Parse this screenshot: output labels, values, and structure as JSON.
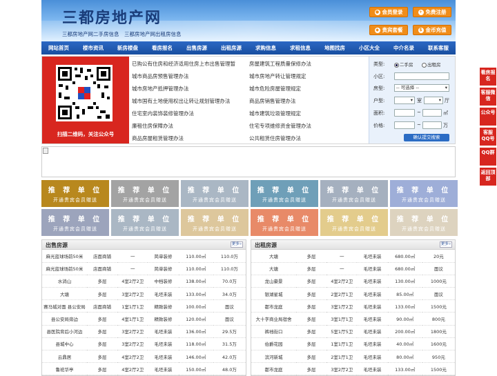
{
  "header": {
    "logo": "三都房地产网",
    "tagline": "三都房地产网二手房信息　三都房地产网出租房信息",
    "buttons": {
      "login": "会员登录",
      "register": "免费注册",
      "package": "贵宾套餐",
      "recharge": "金币充值"
    }
  },
  "nav": [
    "网站首页",
    "楼市资讯",
    "新房楼盘",
    "看房报名",
    "出售房源",
    "出租房源",
    "求购信息",
    "求租信息",
    "地图找房",
    "小区大全",
    "中介名录",
    "联系客服"
  ],
  "qr": {
    "caption": "扫描二维码，关注公众号"
  },
  "links": [
    [
      "已购公有住房和经济适用住房上市出售管理暂",
      "房屋建筑工程质量保修办法"
    ],
    [
      "城市商品房预售管理办法",
      "城市房地产转让管理规定"
    ],
    [
      "城市房地产抵押管理办法",
      "城市危险房屋管理规定"
    ],
    [
      "城市国有土地使用权出让转让规划管理办法",
      "商品房销售管理办法"
    ],
    [
      "住宅室内装饰装修管理办法",
      "城市建筑垃圾管理规定"
    ],
    [
      "廉租住房保障办法",
      "住宅专项维修资金管理办法"
    ],
    [
      "商品房屋租赁管理办法",
      "公共租赁住房管理办法"
    ]
  ],
  "search": {
    "type_label": "类型:",
    "opt_sale": "二手房",
    "opt_rent": "出租房",
    "district_label": "小区:",
    "housetype_label": "房型:",
    "housetype_value": "-- 可选择 --",
    "layout_label": "户型:",
    "room_unit": "室",
    "hall_unit": "厅",
    "area_label": "面积:",
    "area_unit": "㎡",
    "price_label": "价格:",
    "price_unit": "万",
    "range_sep": "~",
    "submit": "确认提交搜索"
  },
  "ads": {
    "title": "推 荐 单 位",
    "sub": "开通贵宾会员赠送",
    "colors": [
      "#b8881e",
      "#a3a3a3",
      "#aab7c4",
      "#6f9fb8",
      "#a5b0bf",
      "#9eaed8",
      "#9ca4bc",
      "#aab7c4",
      "#ddc79c",
      "#e88a68",
      "#e3cc8c",
      "#ddd3bf"
    ]
  },
  "sale": {
    "title": "出售房源",
    "more": "更多»",
    "rows": [
      [
        "麻光蓝球场前50米",
        "店面商铺",
        "一",
        "简单装修",
        "110.00㎡",
        "110.0万"
      ],
      [
        "麻光蓝球场前50米",
        "店面商铺",
        "一",
        "简单装修",
        "110.00㎡",
        "110.0万"
      ],
      [
        "水淌山",
        "多层",
        "4室2厅2卫",
        "中档装修",
        "138.00㎡",
        "70.0万"
      ],
      [
        "大塘",
        "多层",
        "3室2厅2卫",
        "毛坯未装",
        "133.00㎡",
        "34.0万"
      ],
      [
        "赛马城对面 县公安局",
        "店面商铺",
        "1室1厅1卫",
        "精致装修",
        "100.00㎡",
        "面议"
      ],
      [
        "县公安局旁边",
        "多层",
        "4室1厅1卫",
        "精致装修",
        "120.00㎡",
        "面议"
      ],
      [
        "县医院背后小河边",
        "多层",
        "3室2厅2卫",
        "毛坯未装",
        "136.00㎡",
        "29.5万"
      ],
      [
        "县城中心",
        "多层",
        "3室2厅2卫",
        "毛坯未装",
        "118.00㎡",
        "31.5万"
      ],
      [
        "云鼎居",
        "多层",
        "4室2厅2卫",
        "毛坯未装",
        "146.00㎡",
        "42.0万"
      ],
      [
        "鲁班华亭",
        "多层",
        "4室2厅2卫",
        "毛坯未装",
        "150.00㎡",
        "48.0万"
      ]
    ]
  },
  "rent": {
    "title": "出租房源",
    "more": "更多»",
    "rows": [
      [
        "大塘",
        "多层",
        "一",
        "毛坯未装",
        "680.00㎡",
        "20元"
      ],
      [
        "大塘",
        "多层",
        "一",
        "毛坯未装",
        "680.00㎡",
        "面议"
      ],
      [
        "龙山豪景",
        "多层",
        "4室2厅2卫",
        "毛坯未装",
        "130.00㎡",
        "1000元"
      ],
      [
        "银湖星城",
        "多层",
        "2室2厅1卫",
        "毛坯未装",
        "85.00㎡",
        "面议"
      ],
      [
        "都市龙庭",
        "多层",
        "3室1厅2卫",
        "毛坯未装",
        "133.00㎡",
        "1500元"
      ],
      [
        "大十字商业局宿舍",
        "多层",
        "3室1厅1卫",
        "毛坯未装",
        "90.00㎡",
        "800元"
      ],
      [
        "裤裆街口",
        "多层",
        "5室1厅5卫",
        "毛坯未装",
        "200.00㎡",
        "1800元"
      ],
      [
        "伯爵花园",
        "多层",
        "1室1厅1卫",
        "毛坯未装",
        "40.00㎡",
        "1600元"
      ],
      [
        "滨河新城",
        "多层",
        "2室1厅1卫",
        "毛坯未装",
        "80.00㎡",
        "950元"
      ],
      [
        "都市龙庭",
        "多层",
        "3室2厅2卫",
        "毛坯未装",
        "133.00㎡",
        "1500元"
      ]
    ]
  },
  "side": [
    "看房报名",
    "客服微信",
    "公众号",
    "客服QQ号",
    "QQ群",
    "返回顶部"
  ]
}
